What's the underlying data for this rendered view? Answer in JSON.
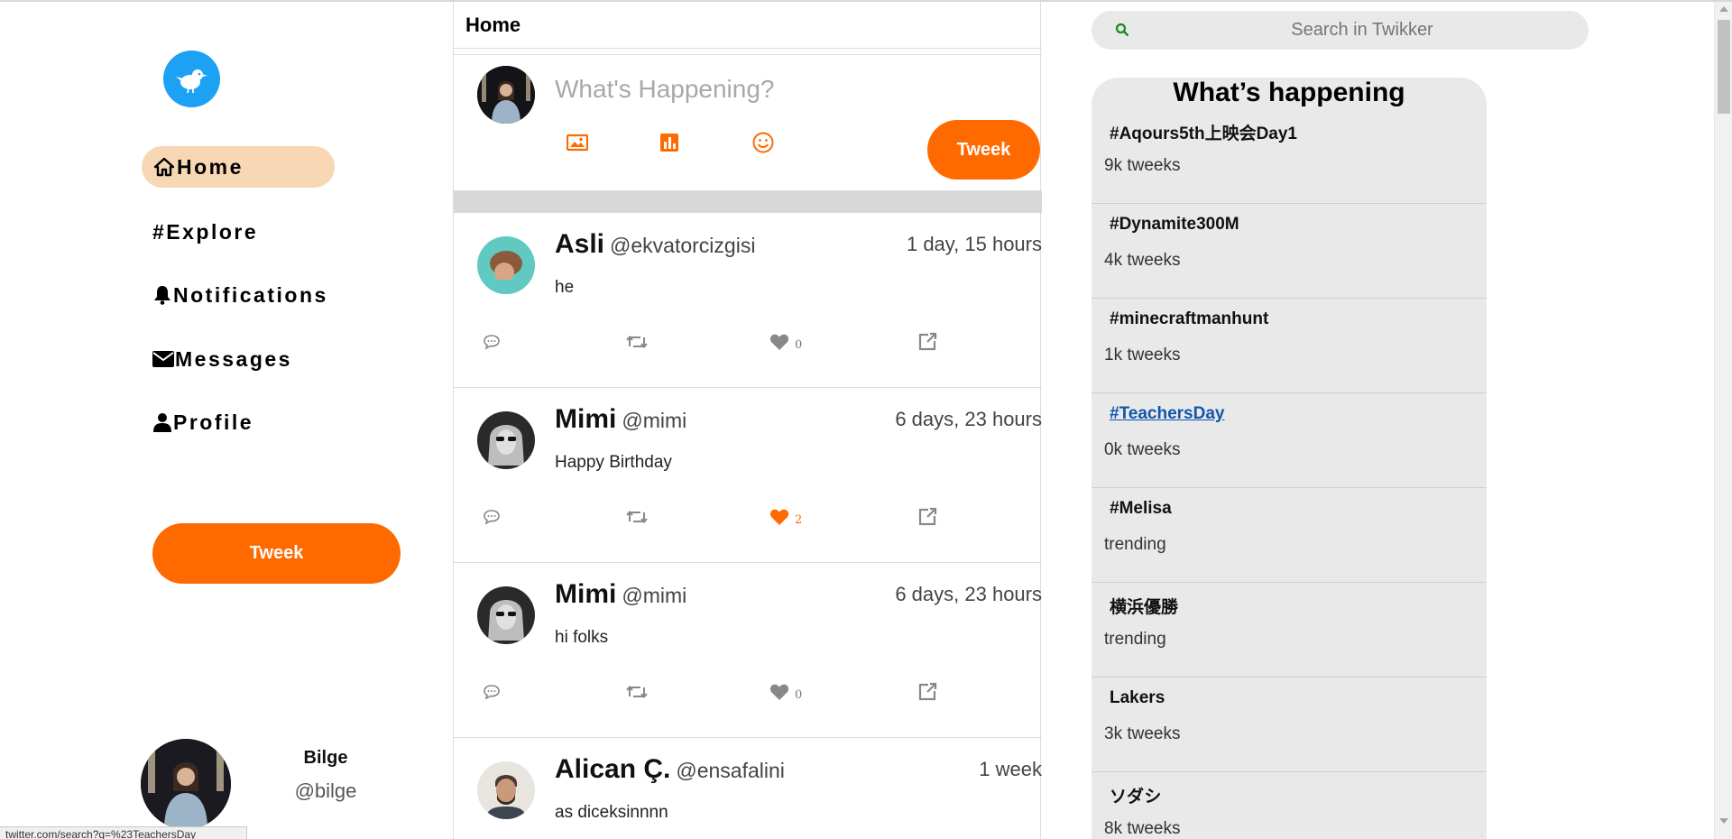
{
  "sidebar": {
    "nav": [
      {
        "label": "Home",
        "icon": "home-icon",
        "active": true
      },
      {
        "label": "#Explore",
        "icon": "",
        "active": false
      },
      {
        "label": "Notifications",
        "icon": "bell-icon",
        "active": false
      },
      {
        "label": "Messages",
        "icon": "envelope-icon",
        "active": false
      },
      {
        "label": " Profile",
        "icon": "user-icon",
        "active": false
      }
    ],
    "tweek_button": "Tweek",
    "user": {
      "name": "Bilge",
      "handle": "@bilge"
    },
    "status_url": "twitter.com/search?q=%23TeachersDay"
  },
  "feed": {
    "title": "Home",
    "compose": {
      "placeholder": "What's Happening?",
      "button": "Tweek"
    },
    "tweets": [
      {
        "name": "Asli",
        "handle": "@ekvatorcizgisi",
        "time": "1 day, 15 hours",
        "text": "he",
        "likes": "0",
        "liked": false
      },
      {
        "name": "Mimi",
        "handle": "@mimi",
        "time": "6 days, 23 hours",
        "text": "Happy Birthday",
        "likes": "2",
        "liked": true
      },
      {
        "name": "Mimi",
        "handle": "@mimi",
        "time": "6 days, 23 hours",
        "text": "hi folks",
        "likes": "0",
        "liked": false
      },
      {
        "name": "Alican Ç.",
        "handle": "@ensafalini",
        "time": "1 week",
        "text": "as diceksinnnn",
        "likes": "",
        "liked": false
      }
    ]
  },
  "right": {
    "search_placeholder": "Search in Twikker",
    "trends_title": "What’s happening",
    "trends": [
      {
        "tag": "#Aqours5th上映会Day1",
        "count": "9k tweeks",
        "link": false
      },
      {
        "tag": "#Dynamite300M",
        "count": "4k tweeks",
        "link": false
      },
      {
        "tag": "#minecraftmanhunt",
        "count": "1k tweeks",
        "link": false
      },
      {
        "tag": "#TeachersDay",
        "count": "0k tweeks",
        "link": true
      },
      {
        "tag": "#Melisa",
        "count": "trending",
        "link": false
      },
      {
        "tag": "横浜優勝",
        "count": "trending",
        "link": false
      },
      {
        "tag": "Lakers",
        "count": "3k tweeks",
        "link": false
      },
      {
        "tag": "ソダシ",
        "count": "8k tweeks",
        "link": false
      }
    ]
  },
  "colors": {
    "accent": "#ff6a00",
    "logo": "#1da1f2",
    "active_nav": "#f8d7b5",
    "link": "#1155aa"
  }
}
